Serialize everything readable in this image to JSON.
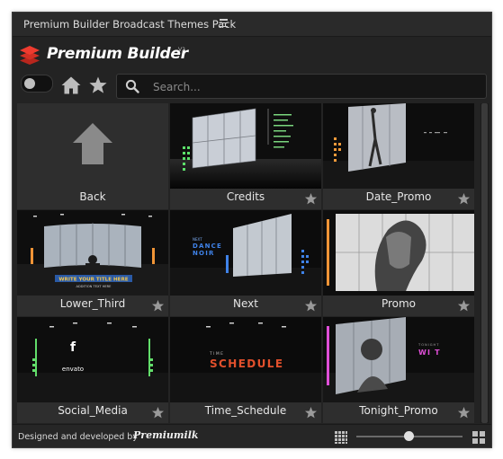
{
  "window": {
    "title": "Premium Builder Broadcast Themes Pack"
  },
  "brand": {
    "name": "Premium Builder",
    "version": "V2",
    "logo_color": "#e8392c"
  },
  "toolbar": {
    "search_placeholder": "Search..."
  },
  "tiles": [
    {
      "label": "Back",
      "kind": "back"
    },
    {
      "label": "Credits",
      "kind": "studio"
    },
    {
      "label": "Date_Promo",
      "kind": "studio"
    },
    {
      "label": "Lower_Third",
      "kind": "studio",
      "overlay_title": "WRITE YOUR TITLE HERE",
      "overlay_sub": "ADDITION TEXT HERE"
    },
    {
      "label": "Next",
      "kind": "studio",
      "overlay_lines": [
        "NEXT",
        "DANCE",
        "NOIR"
      ]
    },
    {
      "label": "Promo",
      "kind": "studio"
    },
    {
      "label": "Social_Media",
      "kind": "studio",
      "overlay_icon": "f",
      "overlay_text": "envato"
    },
    {
      "label": "Time_Schedule",
      "kind": "studio",
      "overlay_small": "TIME",
      "overlay_big": "SCHEDULE"
    },
    {
      "label": "Tonight_Promo",
      "kind": "studio",
      "overlay_small": "TONIGHT",
      "overlay_big": "WI  T"
    }
  ],
  "footer": {
    "credit": "Designed and developed by",
    "signature": "Premiumilk",
    "zoom_level": 0.5
  }
}
